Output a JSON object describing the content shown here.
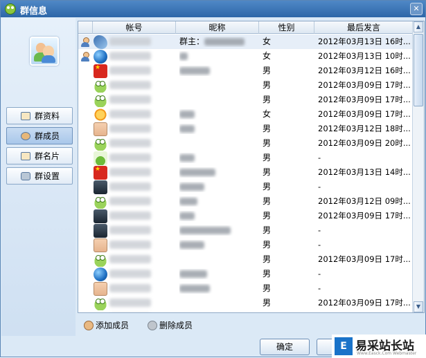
{
  "window": {
    "title": "群信息",
    "close_symbol": "✕"
  },
  "sidebar": {
    "items": [
      {
        "label": "群资料",
        "icon": "profile-card-icon",
        "active": false
      },
      {
        "label": "群成员",
        "icon": "members-icon",
        "active": true
      },
      {
        "label": "群名片",
        "icon": "name-card-icon",
        "active": false
      },
      {
        "label": "群设置",
        "icon": "settings-icon",
        "active": false
      }
    ]
  },
  "table": {
    "columns": [
      "帐号",
      "昵称",
      "性别",
      "最后发言"
    ],
    "rows": [
      {
        "role": "owner",
        "avatar": "fish",
        "nick_prefix": "群主：",
        "sex": "女",
        "last": "2012年03月13日 16时..."
      },
      {
        "role": "admin",
        "avatar": "globe",
        "nick_prefix": "",
        "sex": "女",
        "last": "2012年03月13日 10时..."
      },
      {
        "role": "",
        "avatar": "flag",
        "nick_prefix": "",
        "sex": "男",
        "last": "2012年03月12日 16时..."
      },
      {
        "role": "",
        "avatar": "frog",
        "nick_prefix": "",
        "sex": "男",
        "last": "2012年03月09日 17时..."
      },
      {
        "role": "",
        "avatar": "frog",
        "nick_prefix": "",
        "sex": "男",
        "last": "2012年03月09日 17时..."
      },
      {
        "role": "",
        "avatar": "sun",
        "nick_prefix": "",
        "sex": "女",
        "last": "2012年03月09日 17时..."
      },
      {
        "role": "",
        "avatar": "face",
        "nick_prefix": "",
        "sex": "男",
        "last": "2012年03月12日 18时..."
      },
      {
        "role": "",
        "avatar": "frog",
        "nick_prefix": "",
        "sex": "男",
        "last": "2012年03月09日 20时..."
      },
      {
        "role": "",
        "avatar": "plant",
        "nick_prefix": "",
        "sex": "男",
        "last": "-"
      },
      {
        "role": "",
        "avatar": "flag",
        "nick_prefix": "",
        "sex": "男",
        "last": "2012年03月13日 14时..."
      },
      {
        "role": "",
        "avatar": "dark",
        "nick_prefix": "",
        "sex": "男",
        "last": "-"
      },
      {
        "role": "",
        "avatar": "frog",
        "nick_prefix": "",
        "sex": "男",
        "last": "2012年03月12日 09时..."
      },
      {
        "role": "",
        "avatar": "dark",
        "nick_prefix": "",
        "sex": "男",
        "last": "2012年03月09日 17时..."
      },
      {
        "role": "",
        "avatar": "dark",
        "nick_prefix": "",
        "sex": "男",
        "last": "-"
      },
      {
        "role": "",
        "avatar": "face",
        "nick_prefix": "",
        "sex": "男",
        "last": "-"
      },
      {
        "role": "",
        "avatar": "frog",
        "nick_prefix": "",
        "sex": "男",
        "last": "2012年03月09日 17时..."
      },
      {
        "role": "",
        "avatar": "globe",
        "nick_prefix": "",
        "sex": "男",
        "last": "-"
      },
      {
        "role": "",
        "avatar": "face",
        "nick_prefix": "",
        "sex": "男",
        "last": "-"
      },
      {
        "role": "",
        "avatar": "frog",
        "nick_prefix": "",
        "sex": "男",
        "last": "2012年03月09日 17时..."
      },
      {
        "role": "",
        "avatar": "frog",
        "nick_prefix": "",
        "sex": "男",
        "last": "2012年03月09日 17时..."
      }
    ]
  },
  "actions": {
    "add_member": "添加成员",
    "remove_member": "删除成员"
  },
  "footer": {
    "ok": "确定"
  },
  "scroll": {
    "up": "▲",
    "down": "▼"
  },
  "watermark": {
    "logo": "E",
    "text": "易采站长站",
    "sub": "Www.Easck.Com Webmaster"
  }
}
